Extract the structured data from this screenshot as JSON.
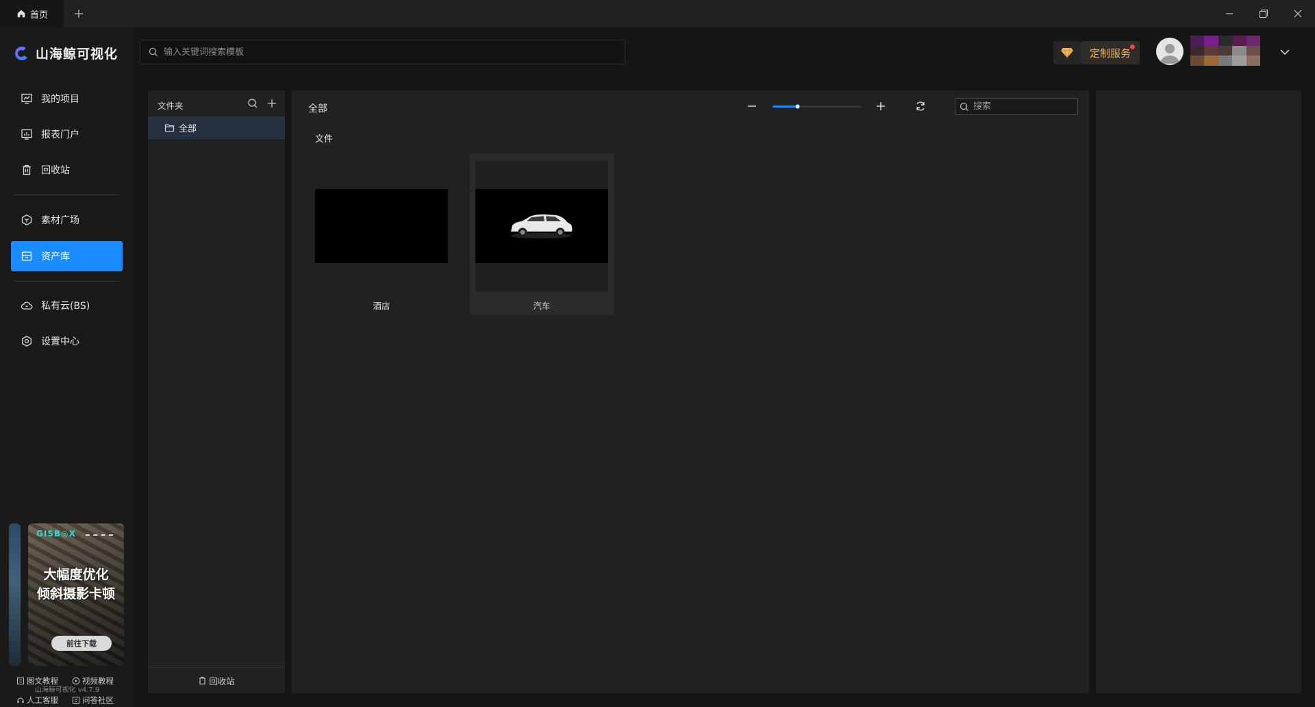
{
  "titlebar": {
    "home_tab": "首页",
    "add_tab": "+"
  },
  "brand": {
    "name": "山海鲸可视化",
    "accent": "#1a8cff"
  },
  "sidebar": {
    "items": [
      {
        "label": "我的项目",
        "icon": "chart-monitor-icon"
      },
      {
        "label": "报表门户",
        "icon": "report-icon"
      },
      {
        "label": "回收站",
        "icon": "trash-icon"
      },
      {
        "label": "素材广场",
        "icon": "cube-icon"
      },
      {
        "label": "资产库",
        "icon": "asset-box-icon",
        "active": true
      },
      {
        "label": "私有云(BS)",
        "icon": "cloud-icon"
      },
      {
        "label": "设置中心",
        "icon": "gear-icon"
      }
    ]
  },
  "promo": {
    "brand": "GISB◎X",
    "line1": "大幅度优化",
    "line2": "倾斜摄影卡顿",
    "button": "前往下载"
  },
  "help": {
    "image_tutorial": "图文教程",
    "video_tutorial": "视频教程",
    "customer_service": "人工客服",
    "qa_community": "问答社区"
  },
  "version": "山海鲸可视化 v4.7.9",
  "header": {
    "search_placeholder": "输入关键词搜索模板",
    "custom_service": "定制服务"
  },
  "folder_panel": {
    "title": "文件夹",
    "items": [
      {
        "label": "全部",
        "selected": true
      }
    ],
    "recycle": "回收站"
  },
  "main": {
    "title": "全部",
    "search_placeholder": "搜索",
    "zoom_level": 0.28,
    "section": "文件",
    "files": [
      {
        "name": "酒店"
      },
      {
        "name": "汽车"
      }
    ]
  }
}
